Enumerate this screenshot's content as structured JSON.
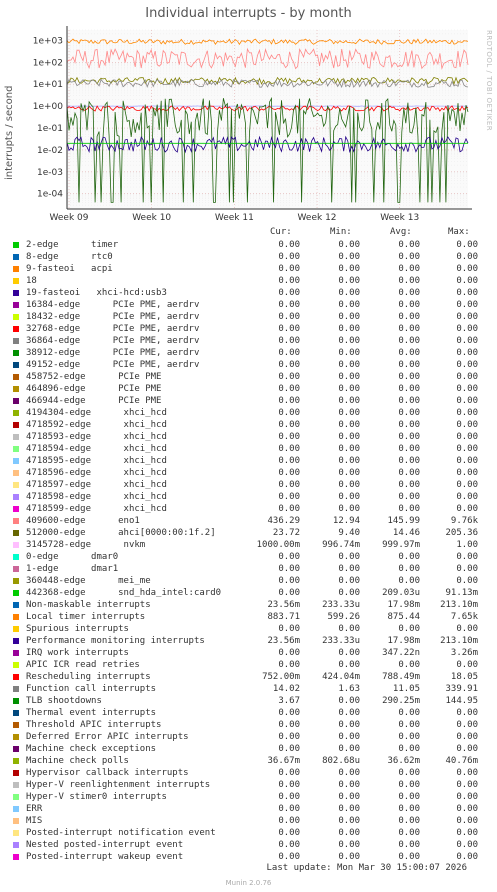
{
  "chart_data": {
    "type": "line",
    "title": "Individual interrupts - by month",
    "ylabel": "interrupts / second",
    "yscale": "log",
    "ylim": [
      2e-05,
      3000
    ],
    "y_ticks": [
      "1e-04",
      "1e-03",
      "1e-02",
      "1e-01",
      "1e+00",
      "1e+01",
      "1e+02",
      "1e+03"
    ],
    "x_ticks": [
      "Week 09",
      "Week 10",
      "Week 11",
      "Week 12",
      "Week 13"
    ],
    "grid": true,
    "series_levels": [
      {
        "name": "Local timer interrupts",
        "color": "#ff8800",
        "value": 875.44
      },
      {
        "name": "409600-edge eno1",
        "color": "#ff8888",
        "value": 145.99
      },
      {
        "name": "512000-edge ahci[0000:00:1f.2]",
        "color": "#808000",
        "value": 14.46
      },
      {
        "name": "Function call interrupts",
        "color": "#888888",
        "value": 11.05
      },
      {
        "name": "3145728-edge nvkm",
        "color": "#aaaaff",
        "value": 1.0
      },
      {
        "name": "Rescheduling interrupts",
        "color": "#ff0000",
        "value": 0.788
      },
      {
        "name": "TLB shootdowns",
        "color": "#226611",
        "value": 0.29
      },
      {
        "name": "Performance monitoring interrupts",
        "color": "#220088",
        "value": 0.018
      },
      {
        "name": "442368-edge snd_hda_intel:card0",
        "color": "#00cc00",
        "value": 0.02
      }
    ]
  },
  "rrdtool_label": "RRDTOOL / TOBI OETIKER",
  "legend_headers": {
    "cur": "Cur:",
    "min": "Min:",
    "avg": "Avg:",
    "max": "Max:"
  },
  "legend": [
    {
      "name": "2-edge      timer",
      "color": "#00cc00",
      "cur": "0.00",
      "min": "0.00",
      "avg": "0.00",
      "max": "0.00"
    },
    {
      "name": "8-edge      rtc0",
      "color": "#0066b3",
      "cur": "0.00",
      "min": "0.00",
      "avg": "0.00",
      "max": "0.00"
    },
    {
      "name": "9-fasteoi   acpi",
      "color": "#ff8000",
      "cur": "0.00",
      "min": "0.00",
      "avg": "0.00",
      "max": "0.00"
    },
    {
      "name": "18",
      "color": "#ffcc00",
      "cur": "0.00",
      "min": "0.00",
      "avg": "0.00",
      "max": "0.00"
    },
    {
      "name": "19-fasteoi   xhci-hcd:usb3",
      "color": "#330099",
      "cur": "0.00",
      "min": "0.00",
      "avg": "0.00",
      "max": "0.00"
    },
    {
      "name": "16384-edge      PCIe PME, aerdrv",
      "color": "#990099",
      "cur": "0.00",
      "min": "0.00",
      "avg": "0.00",
      "max": "0.00"
    },
    {
      "name": "18432-edge      PCIe PME, aerdrv",
      "color": "#ccff00",
      "cur": "0.00",
      "min": "0.00",
      "avg": "0.00",
      "max": "0.00"
    },
    {
      "name": "32768-edge      PCIe PME, aerdrv",
      "color": "#ff0000",
      "cur": "0.00",
      "min": "0.00",
      "avg": "0.00",
      "max": "0.00"
    },
    {
      "name": "36864-edge      PCIe PME, aerdrv",
      "color": "#808080",
      "cur": "0.00",
      "min": "0.00",
      "avg": "0.00",
      "max": "0.00"
    },
    {
      "name": "38912-edge      PCIe PME, aerdrv",
      "color": "#008f00",
      "cur": "0.00",
      "min": "0.00",
      "avg": "0.00",
      "max": "0.00"
    },
    {
      "name": "49152-edge      PCIe PME, aerdrv",
      "color": "#00487d",
      "cur": "0.00",
      "min": "0.00",
      "avg": "0.00",
      "max": "0.00"
    },
    {
      "name": "458752-edge      PCIe PME",
      "color": "#b35a00",
      "cur": "0.00",
      "min": "0.00",
      "avg": "0.00",
      "max": "0.00"
    },
    {
      "name": "464896-edge      PCIe PME",
      "color": "#b38f00",
      "cur": "0.00",
      "min": "0.00",
      "avg": "0.00",
      "max": "0.00"
    },
    {
      "name": "466944-edge      PCIe PME",
      "color": "#6b006b",
      "cur": "0.00",
      "min": "0.00",
      "avg": "0.00",
      "max": "0.00"
    },
    {
      "name": "4194304-edge      xhci_hcd",
      "color": "#8fb300",
      "cur": "0.00",
      "min": "0.00",
      "avg": "0.00",
      "max": "0.00"
    },
    {
      "name": "4718592-edge      xhci_hcd",
      "color": "#b30000",
      "cur": "0.00",
      "min": "0.00",
      "avg": "0.00",
      "max": "0.00"
    },
    {
      "name": "4718593-edge      xhci_hcd",
      "color": "#bebebe",
      "cur": "0.00",
      "min": "0.00",
      "avg": "0.00",
      "max": "0.00"
    },
    {
      "name": "4718594-edge      xhci_hcd",
      "color": "#80ff80",
      "cur": "0.00",
      "min": "0.00",
      "avg": "0.00",
      "max": "0.00"
    },
    {
      "name": "4718595-edge      xhci_hcd",
      "color": "#80c9ff",
      "cur": "0.00",
      "min": "0.00",
      "avg": "0.00",
      "max": "0.00"
    },
    {
      "name": "4718596-edge      xhci_hcd",
      "color": "#ffc080",
      "cur": "0.00",
      "min": "0.00",
      "avg": "0.00",
      "max": "0.00"
    },
    {
      "name": "4718597-edge      xhci_hcd",
      "color": "#ffe680",
      "cur": "0.00",
      "min": "0.00",
      "avg": "0.00",
      "max": "0.00"
    },
    {
      "name": "4718598-edge      xhci_hcd",
      "color": "#aa80ff",
      "cur": "0.00",
      "min": "0.00",
      "avg": "0.00",
      "max": "0.00"
    },
    {
      "name": "4718599-edge      xhci_hcd",
      "color": "#ee00cc",
      "cur": "0.00",
      "min": "0.00",
      "avg": "0.00",
      "max": "0.00"
    },
    {
      "name": "409600-edge      eno1",
      "color": "#ff8080",
      "cur": "436.29",
      "min": "12.94",
      "avg": "145.99",
      "max": "9.76k"
    },
    {
      "name": "512000-edge      ahci[0000:00:1f.2]",
      "color": "#666600",
      "cur": "23.72",
      "min": "9.40",
      "avg": "14.46",
      "max": "205.36"
    },
    {
      "name": "3145728-edge      nvkm",
      "color": "#ffbfff",
      "cur": "1000.00m",
      "min": "996.74m",
      "avg": "999.97m",
      "max": "1.00"
    },
    {
      "name": "0-edge      dmar0",
      "color": "#00ffcc",
      "cur": "0.00",
      "min": "0.00",
      "avg": "0.00",
      "max": "0.00"
    },
    {
      "name": "1-edge      dmar1",
      "color": "#cc6699",
      "cur": "0.00",
      "min": "0.00",
      "avg": "0.00",
      "max": "0.00"
    },
    {
      "name": "360448-edge      mei_me",
      "color": "#999900",
      "cur": "0.00",
      "min": "0.00",
      "avg": "0.00",
      "max": "0.00"
    },
    {
      "name": "442368-edge      snd_hda_intel:card0",
      "color": "#00cc00",
      "cur": "0.00",
      "min": "0.00",
      "avg": "209.03u",
      "max": "91.13m"
    },
    {
      "name": "Non-maskable interrupts",
      "color": "#0066b3",
      "cur": "23.56m",
      "min": "233.33u",
      "avg": "17.98m",
      "max": "213.10m"
    },
    {
      "name": "Local timer interrupts",
      "color": "#ff8000",
      "cur": "883.71",
      "min": "599.26",
      "avg": "875.44",
      "max": "7.65k"
    },
    {
      "name": "Spurious interrupts",
      "color": "#ffcc00",
      "cur": "0.00",
      "min": "0.00",
      "avg": "0.00",
      "max": "0.00"
    },
    {
      "name": "Performance monitoring interrupts",
      "color": "#330099",
      "cur": "23.56m",
      "min": "233.33u",
      "avg": "17.98m",
      "max": "213.10m"
    },
    {
      "name": "IRQ work interrupts",
      "color": "#990099",
      "cur": "0.00",
      "min": "0.00",
      "avg": "347.22n",
      "max": "3.26m"
    },
    {
      "name": "APIC ICR read retries",
      "color": "#ccff00",
      "cur": "0.00",
      "min": "0.00",
      "avg": "0.00",
      "max": "0.00"
    },
    {
      "name": "Rescheduling interrupts",
      "color": "#ff0000",
      "cur": "752.00m",
      "min": "424.04m",
      "avg": "788.49m",
      "max": "18.05"
    },
    {
      "name": "Function call interrupts",
      "color": "#808080",
      "cur": "14.02",
      "min": "1.63",
      "avg": "11.05",
      "max": "339.91"
    },
    {
      "name": "TLB shootdowns",
      "color": "#008f00",
      "cur": "3.67",
      "min": "0.00",
      "avg": "290.25m",
      "max": "144.95"
    },
    {
      "name": "Thermal event interrupts",
      "color": "#00487d",
      "cur": "0.00",
      "min": "0.00",
      "avg": "0.00",
      "max": "0.00"
    },
    {
      "name": "Threshold APIC interrupts",
      "color": "#b35a00",
      "cur": "0.00",
      "min": "0.00",
      "avg": "0.00",
      "max": "0.00"
    },
    {
      "name": "Deferred Error APIC interrupts",
      "color": "#b38f00",
      "cur": "0.00",
      "min": "0.00",
      "avg": "0.00",
      "max": "0.00"
    },
    {
      "name": "Machine check exceptions",
      "color": "#6b006b",
      "cur": "0.00",
      "min": "0.00",
      "avg": "0.00",
      "max": "0.00"
    },
    {
      "name": "Machine check polls",
      "color": "#8fb300",
      "cur": "36.67m",
      "min": "802.68u",
      "avg": "36.62m",
      "max": "40.76m"
    },
    {
      "name": "Hypervisor callback interrupts",
      "color": "#b30000",
      "cur": "0.00",
      "min": "0.00",
      "avg": "0.00",
      "max": "0.00"
    },
    {
      "name": "Hyper-V reenlightenment interrupts",
      "color": "#bebebe",
      "cur": "0.00",
      "min": "0.00",
      "avg": "0.00",
      "max": "0.00"
    },
    {
      "name": "Hyper-V stimer0 interrupts",
      "color": "#80ff80",
      "cur": "0.00",
      "min": "0.00",
      "avg": "0.00",
      "max": "0.00"
    },
    {
      "name": "ERR",
      "color": "#80c9ff",
      "cur": "0.00",
      "min": "0.00",
      "avg": "0.00",
      "max": "0.00"
    },
    {
      "name": "MIS",
      "color": "#ffc080",
      "cur": "0.00",
      "min": "0.00",
      "avg": "0.00",
      "max": "0.00"
    },
    {
      "name": "Posted-interrupt notification event",
      "color": "#ffe680",
      "cur": "0.00",
      "min": "0.00",
      "avg": "0.00",
      "max": "0.00"
    },
    {
      "name": "Nested posted-interrupt event",
      "color": "#aa80ff",
      "cur": "0.00",
      "min": "0.00",
      "avg": "0.00",
      "max": "0.00"
    },
    {
      "name": "Posted-interrupt wakeup event",
      "color": "#ee00cc",
      "cur": "0.00",
      "min": "0.00",
      "avg": "0.00",
      "max": "0.00"
    }
  ],
  "last_update": "Last update: Mon Mar 30 15:00:07 2026",
  "footer": "Munin 2.0.76"
}
